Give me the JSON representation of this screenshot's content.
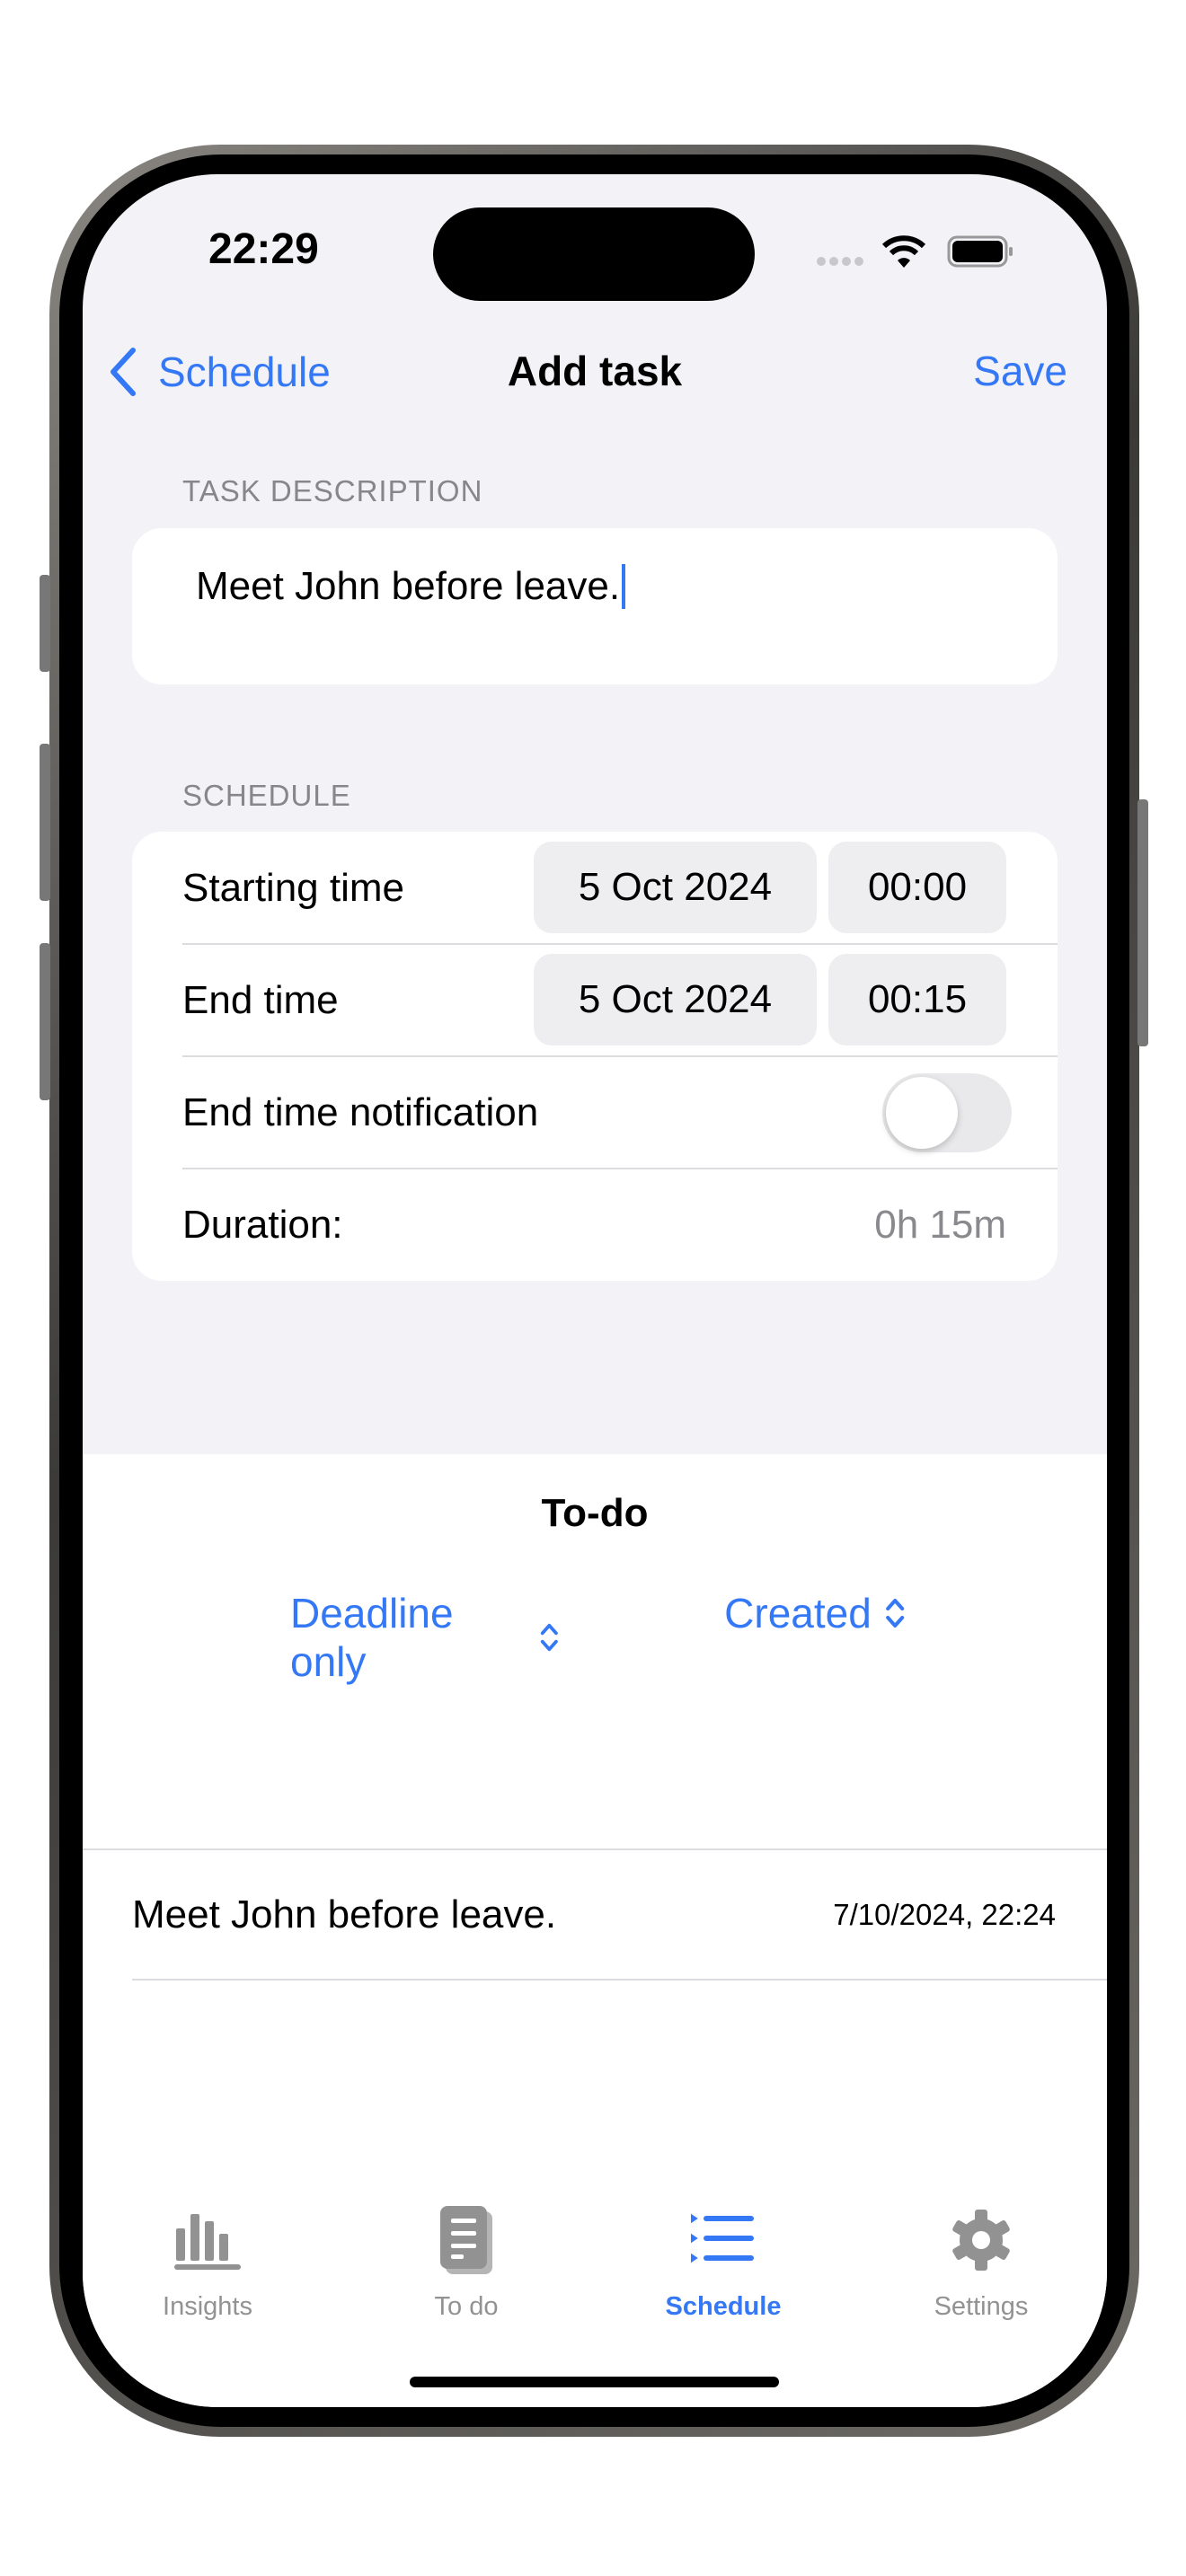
{
  "status_bar": {
    "time": "22:29"
  },
  "nav": {
    "back_label": "Schedule",
    "title": "Add task",
    "save_label": "Save"
  },
  "task_description": {
    "section_label": "TASK DESCRIPTION",
    "value": "Meet John before leave."
  },
  "schedule": {
    "section_label": "SCHEDULE",
    "starting_time": {
      "label": "Starting time",
      "date": "5 Oct 2024",
      "time": "00:00"
    },
    "end_time": {
      "label": "End time",
      "date": "5 Oct 2024",
      "time": "00:15"
    },
    "notification": {
      "label": "End time notification",
      "enabled": false
    },
    "duration": {
      "label": "Duration:",
      "value": "0h 15m"
    }
  },
  "todo": {
    "title": "To-do",
    "filter": "Deadline only",
    "sort": "Created",
    "items": [
      {
        "text": "Meet John before leave.",
        "date": "7/10/2024, 22:24"
      }
    ]
  },
  "tabs": [
    {
      "label": "Insights",
      "icon": "chart-bar-icon",
      "active": false
    },
    {
      "label": "To do",
      "icon": "document-icon",
      "active": false
    },
    {
      "label": "Schedule",
      "icon": "list-bullet-icon",
      "active": true
    },
    {
      "label": "Settings",
      "icon": "gear-icon",
      "active": false
    }
  ],
  "colors": {
    "accent": "#3478f6",
    "background": "#f2f2f7",
    "inactive": "#929292"
  }
}
